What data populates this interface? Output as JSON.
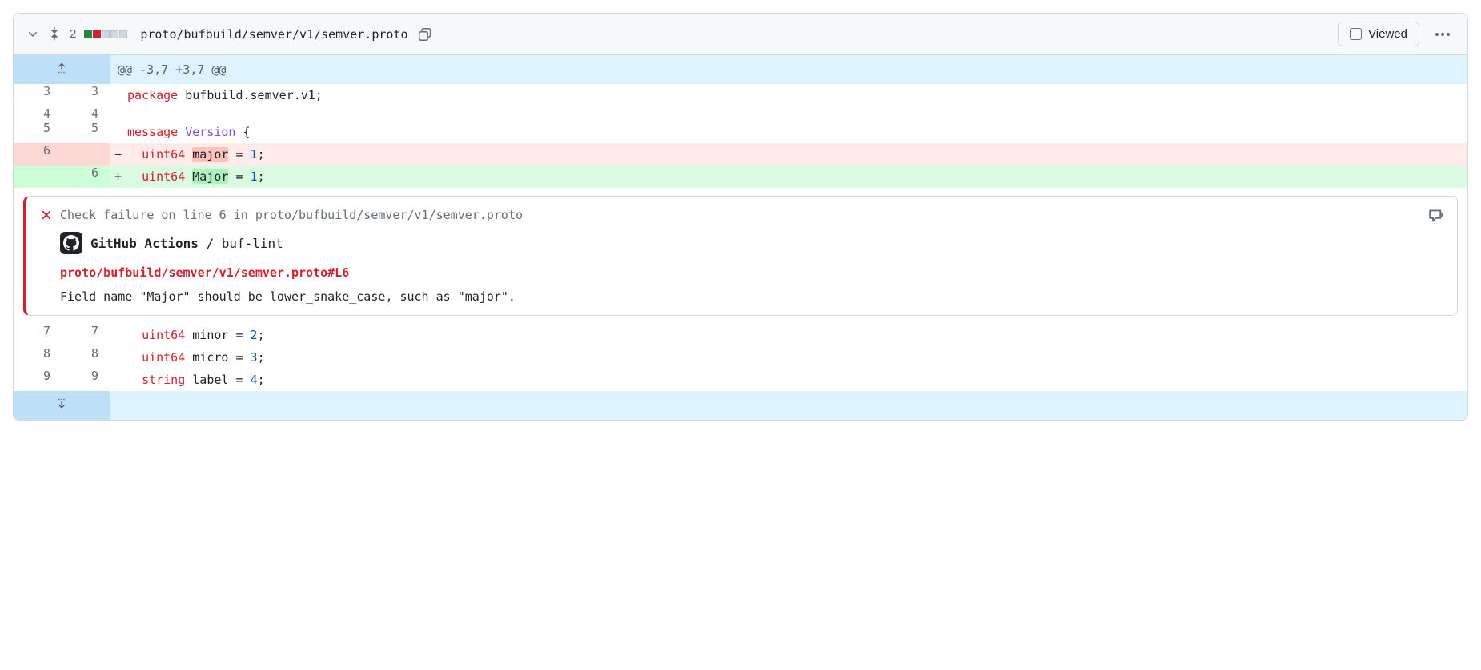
{
  "header": {
    "change_count": "2",
    "file_path": "proto/bufbuild/semver/v1/semver.proto",
    "viewed_label": "Viewed"
  },
  "hunk": {
    "header": "@@ -3,7 +3,7 @@"
  },
  "lines": {
    "l0": {
      "old": "3",
      "new": "3"
    },
    "l1": {
      "old": "4",
      "new": "4"
    },
    "l2": {
      "old": "5",
      "new": "5"
    },
    "l3": {
      "old": "6",
      "new": ""
    },
    "l4": {
      "old": "",
      "new": "6"
    },
    "l5": {
      "old": "7",
      "new": "7"
    },
    "l6": {
      "old": "8",
      "new": "8"
    },
    "l7": {
      "old": "9",
      "new": "9"
    }
  },
  "code": {
    "l0": {
      "kw": "package",
      "rest": " bufbuild.semver.v1;"
    },
    "l2": {
      "kw": "message",
      "type": " Version",
      "rest": " {"
    },
    "l3": {
      "ind": "  ",
      "kw": "uint64",
      "field": "major",
      "eq": " = ",
      "num": "1",
      "semi": ";"
    },
    "l4": {
      "ind": "  ",
      "kw": "uint64",
      "field": "Major",
      "eq": " = ",
      "num": "1",
      "semi": ";"
    },
    "l5": {
      "ind": "  ",
      "kw": "uint64",
      "field": " minor",
      "eq": " = ",
      "num": "2",
      "semi": ";"
    },
    "l6": {
      "ind": "  ",
      "kw": "uint64",
      "field": " micro",
      "eq": " = ",
      "num": "3",
      "semi": ";"
    },
    "l7": {
      "ind": "  ",
      "kw": "string",
      "field": " label",
      "eq": " = ",
      "num": "4",
      "semi": ";"
    }
  },
  "annotation": {
    "header_text": "Check failure on line 6 in proto/bufbuild/semver/v1/semver.proto",
    "app_name": "GitHub Actions",
    "check_name": " / buf-lint",
    "link": "proto/bufbuild/semver/v1/semver.proto#L6",
    "message": "Field name \"Major\" should be lower_snake_case, such as \"major\"."
  }
}
